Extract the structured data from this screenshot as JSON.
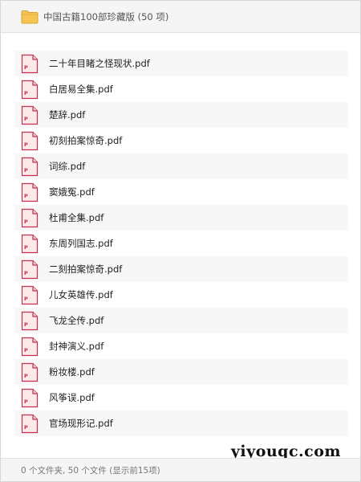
{
  "header": {
    "icon": "folder-icon",
    "title": "中国古籍100部珍藏版 (50 项)"
  },
  "files": [
    {
      "name": "二十年目睹之怪现状.pdf",
      "icon": "pdf-file-icon"
    },
    {
      "name": "白居易全集.pdf",
      "icon": "pdf-file-icon"
    },
    {
      "name": "楚辞.pdf",
      "icon": "pdf-file-icon"
    },
    {
      "name": "初刻拍案惊奇.pdf",
      "icon": "pdf-file-icon"
    },
    {
      "name": "词综.pdf",
      "icon": "pdf-file-icon"
    },
    {
      "name": "窦娥冤.pdf",
      "icon": "pdf-file-icon"
    },
    {
      "name": "杜甫全集.pdf",
      "icon": "pdf-file-icon"
    },
    {
      "name": "东周列国志.pdf",
      "icon": "pdf-file-icon"
    },
    {
      "name": "二刻拍案惊奇.pdf",
      "icon": "pdf-file-icon"
    },
    {
      "name": "儿女英雄传.pdf",
      "icon": "pdf-file-icon"
    },
    {
      "name": "飞龙全传.pdf",
      "icon": "pdf-file-icon"
    },
    {
      "name": "封神演义.pdf",
      "icon": "pdf-file-icon"
    },
    {
      "name": "粉妆楼.pdf",
      "icon": "pdf-file-icon"
    },
    {
      "name": "风筝误.pdf",
      "icon": "pdf-file-icon"
    },
    {
      "name": "官场现形记.pdf",
      "icon": "pdf-file-icon"
    }
  ],
  "watermark": "yiyouqc.com",
  "footer": {
    "status": "0 个文件夹, 50 个文件 (显示前15项)"
  },
  "colors": {
    "folder": "#f5c451",
    "pdf_icon_border": "#c0334d",
    "pdf_icon_fill": "#fde8ea",
    "alt_row": "#f7f7f7"
  }
}
